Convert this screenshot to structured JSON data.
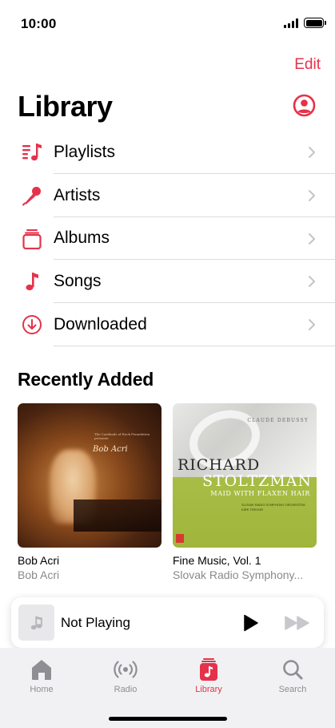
{
  "status_bar": {
    "time": "10:00"
  },
  "header": {
    "edit_label": "Edit",
    "title": "Library"
  },
  "library_items": [
    {
      "label": "Playlists",
      "icon": "playlists-icon"
    },
    {
      "label": "Artists",
      "icon": "microphone-icon"
    },
    {
      "label": "Albums",
      "icon": "albums-icon"
    },
    {
      "label": "Songs",
      "icon": "music-note-icon"
    },
    {
      "label": "Downloaded",
      "icon": "download-icon"
    }
  ],
  "recently_added": {
    "title": "Recently Added",
    "albums": [
      {
        "title": "Bob Acri",
        "artist": "Bob Acri",
        "cover_text": "Bob Acri",
        "cover_subtext": "The Cardinals of Rock Foundation presents",
        "cover_tracks": "Gene Gelly Lounge Was See Fella 12 Triggers Fresh Bass"
      },
      {
        "title": "Fine Music, Vol. 1",
        "artist": "Slovak Radio Symphony...",
        "cover_composer": "CLAUDE DEBUSSY",
        "cover_line1": "RICHARD",
        "cover_line2": "STOLTZMAN",
        "cover_work": "MAID WITH FLAXEN HAIR",
        "cover_orchestra": "SLOVAK RADIO SYMPHONY ORCHESTRA",
        "cover_conductor": "KIRK TREVOR"
      }
    ]
  },
  "mini_player": {
    "title": "Not Playing"
  },
  "tabs": [
    {
      "label": "Home",
      "icon": "home-icon",
      "active": false
    },
    {
      "label": "Radio",
      "icon": "radio-icon",
      "active": false
    },
    {
      "label": "Library",
      "icon": "library-icon",
      "active": true
    },
    {
      "label": "Search",
      "icon": "search-icon",
      "active": false
    }
  ],
  "colors": {
    "accent": "#e5324a",
    "secondary_text": "#8a8a8e",
    "tab_bar": "#f1f1f3"
  }
}
